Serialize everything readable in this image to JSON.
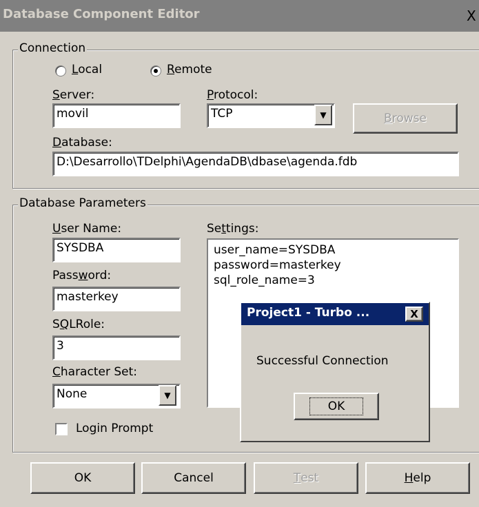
{
  "window": {
    "title": "Database Component Editor",
    "close_glyph": "X"
  },
  "connection": {
    "group_label": "Connection",
    "local_label": "Local",
    "remote_label": "Remote",
    "mode_selected": "Remote",
    "server_label": "Server:",
    "server_value": "movil",
    "protocol_label": "Protocol:",
    "protocol_value": "TCP",
    "browse_label": "Browse",
    "database_label": "Database:",
    "database_value": "D:\\Desarrollo\\TDelphi\\AgendaDB\\dbase\\agenda.fdb"
  },
  "parameters": {
    "group_label": "Database Parameters",
    "username_label": "User Name:",
    "username_value": "SYSDBA",
    "password_label": "Password:",
    "password_value": "masterkey",
    "sqlrole_label": "SQLRole:",
    "sqlrole_value": "3",
    "charset_label": "Character Set:",
    "charset_value": "None",
    "login_prompt_label": "Login Prompt",
    "login_prompt_checked": false,
    "settings_label": "Settings:",
    "settings_lines": [
      "user_name=SYSDBA",
      "password=masterkey",
      "sql_role_name=3"
    ]
  },
  "buttons": {
    "ok": "OK",
    "cancel": "Cancel",
    "test": "Test",
    "help": "Help"
  },
  "message_box": {
    "title": "Project1 - Turbo ...",
    "close_glyph": "X",
    "text": "Successful Connection",
    "ok_label": "OK"
  },
  "colors": {
    "face": "#d4d0c8",
    "inactive_title": "#808080",
    "active_title": "#0a246a"
  },
  "icons": {
    "dropdown": "chevron-down-icon",
    "close": "close-icon"
  }
}
